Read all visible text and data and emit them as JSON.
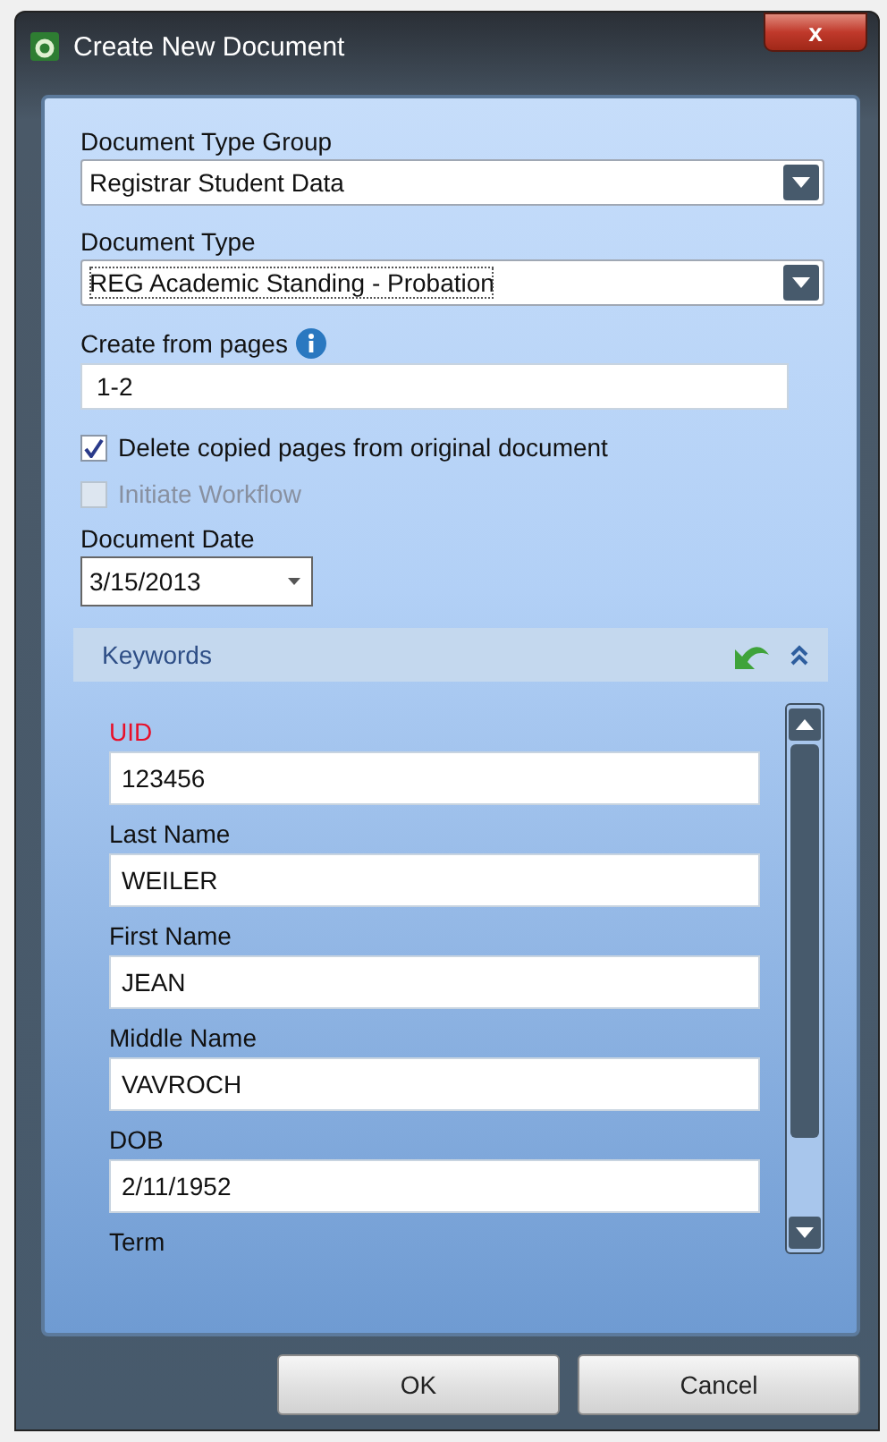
{
  "window": {
    "title": "Create New Document",
    "close": "x"
  },
  "document_type_group": {
    "label": "Document Type Group",
    "value": "Registrar Student Data"
  },
  "document_type": {
    "label": "Document Type",
    "value": "REG Academic Standing - Probation",
    "focused": true
  },
  "create_from_pages": {
    "label": "Create from pages",
    "value": "1-2"
  },
  "checkboxes": [
    {
      "label": "Delete copied pages from original document",
      "checked": true,
      "disabled": false
    },
    {
      "label": "Initiate Workflow",
      "checked": false,
      "disabled": true
    }
  ],
  "document_date": {
    "label": "Document Date",
    "value": "3/15/2013"
  },
  "keywords": {
    "title": "Keywords",
    "expanded": true,
    "fields": [
      {
        "label": "UID",
        "value": "123456",
        "required": true
      },
      {
        "label": "Last Name",
        "value": "WEILER",
        "required": false
      },
      {
        "label": "First Name",
        "value": "JEAN",
        "required": false
      },
      {
        "label": "Middle Name",
        "value": "VAVROCH",
        "required": false
      },
      {
        "label": "DOB",
        "value": "2/11/1952",
        "required": false
      },
      {
        "label": "Term",
        "required": false
      }
    ]
  },
  "buttons": [
    "OK",
    "Cancel"
  ]
}
